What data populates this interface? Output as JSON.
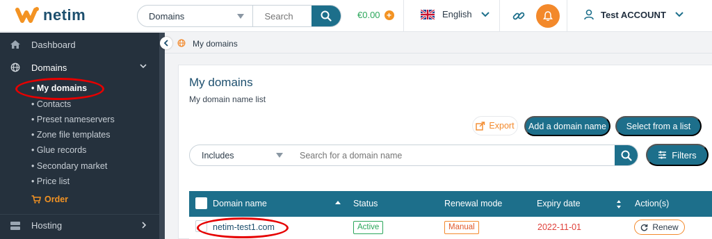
{
  "brand": {
    "name": "netim",
    "accent": "#f3892b",
    "primary": "#1d6f8b"
  },
  "header": {
    "search_scope": "Domains",
    "search_placeholder": "Search",
    "balance": "€0.00",
    "language": "English",
    "account_name": "Test ACCOUNT"
  },
  "sidebar": {
    "dashboard": "Dashboard",
    "domains": "Domains",
    "sub_items": [
      "My domains",
      "Contacts",
      "Preset nameservers",
      "Zone file templates",
      "Glue records",
      "Secondary market",
      "Price list"
    ],
    "order": "Order",
    "hosting": "Hosting"
  },
  "breadcrumb": "My domains",
  "page": {
    "title": "My domains",
    "subtitle": "My domain name list",
    "export": "Export",
    "add_domain": "Add a domain name",
    "select_list": "Select from a list",
    "filter_mode": "Includes",
    "filter_placeholder": "Search for a domain name",
    "filters": "Filters"
  },
  "table": {
    "columns": [
      "Domain name",
      "Status",
      "Renewal mode",
      "Expiry date",
      "Action(s)"
    ],
    "rows": [
      {
        "domain": "netim-test1.com",
        "status": "Active",
        "renewal": "Manual",
        "expiry": "2022-11-01",
        "action": "Renew"
      }
    ]
  }
}
